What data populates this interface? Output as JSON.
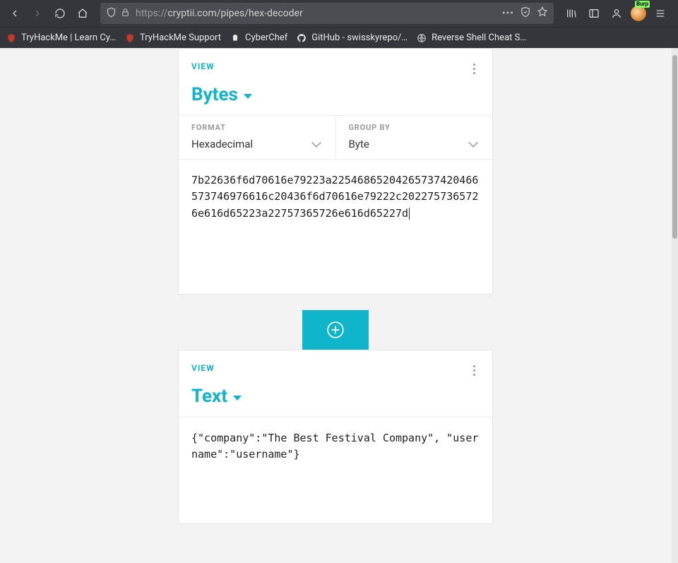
{
  "browser": {
    "url_proto": "https://",
    "url_host_path": "cryptii.com/pipes/hex-decoder",
    "bookmarks": [
      {
        "label": "TryHackMe | Learn Cy…",
        "icon": "shield-red"
      },
      {
        "label": "TryHackMe Support",
        "icon": "shield-red"
      },
      {
        "label": "CyberChef",
        "icon": "chef"
      },
      {
        "label": "GitHub - swisskyrepo/…",
        "icon": "github"
      },
      {
        "label": "Reverse Shell Cheat S…",
        "icon": "globe"
      }
    ],
    "burp_label": "Burp"
  },
  "card1": {
    "view_label": "VIEW",
    "title": "Bytes",
    "format_label": "FORMAT",
    "format_value": "Hexadecimal",
    "groupby_label": "GROUP BY",
    "groupby_value": "Byte",
    "content": "7b22636f6d70616e79223a22546865204265737420466573746976616c20436f6d70616e79222c2022757365726e616d65223a22757365726e616d65227d"
  },
  "card2": {
    "view_label": "VIEW",
    "title": "Text",
    "content": "{\"company\":\"The Best Festival Company\", \"username\":\"username\"}"
  }
}
